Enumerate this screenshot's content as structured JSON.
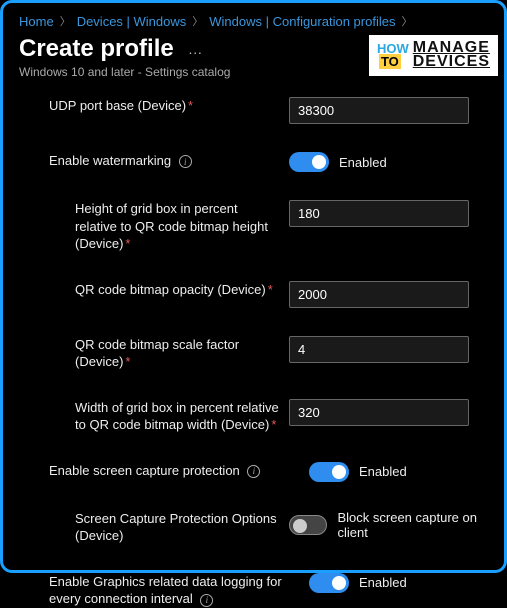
{
  "breadcrumb": {
    "home": "Home",
    "devices": "Devices | Windows",
    "profiles": "Windows | Configuration profiles"
  },
  "header": {
    "title": "Create profile",
    "subtitle": "Windows 10 and later - Settings catalog"
  },
  "logo": {
    "how": "HOW",
    "to": "TO",
    "manage": "MANAGE",
    "devices": "DEVICES"
  },
  "fields": {
    "udp_label": "UDP port base (Device)",
    "udp_value": "38300",
    "enable_watermark_label": "Enable watermarking",
    "enable_watermark_state": "Enabled",
    "height_label": "Height of grid box in percent relative to QR code bitmap height (Device)",
    "height_value": "180",
    "opacity_label": "QR code bitmap opacity (Device)",
    "opacity_value": "2000",
    "scale_label": "QR code bitmap scale factor (Device)",
    "scale_value": "4",
    "width_label": "Width of grid box in percent relative to QR code bitmap width (Device)",
    "width_value": "320",
    "screen_cap_label": "Enable screen capture protection",
    "screen_cap_state": "Enabled",
    "screen_cap_opt_label": "Screen Capture Protection Options (Device)",
    "screen_cap_opt_state": "Block screen capture on client",
    "graphics_label": "Enable Graphics related data logging for every connection interval",
    "graphics_state": "Enabled"
  }
}
